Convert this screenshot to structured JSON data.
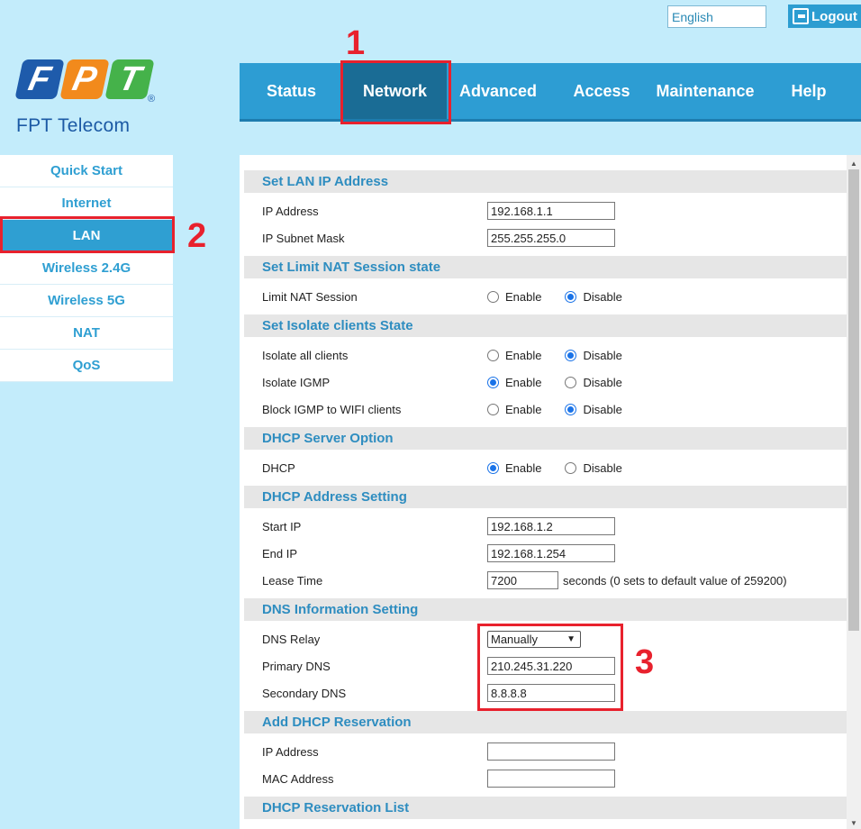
{
  "header": {
    "language": "English",
    "logout_label": "Logout",
    "brand": {
      "letters": [
        "F",
        "P",
        "T"
      ],
      "registered": "®",
      "name": "FPT Telecom"
    }
  },
  "nav": {
    "items": [
      {
        "label": "Status"
      },
      {
        "label": "Network",
        "active": true
      },
      {
        "label": "Advanced"
      },
      {
        "label": "Access"
      },
      {
        "label": "Maintenance"
      },
      {
        "label": "Help"
      }
    ]
  },
  "sidebar": {
    "items": [
      {
        "label": "Quick Start"
      },
      {
        "label": "Internet"
      },
      {
        "label": "LAN",
        "active": true
      },
      {
        "label": "Wireless 2.4G"
      },
      {
        "label": "Wireless 5G"
      },
      {
        "label": "NAT"
      },
      {
        "label": "QoS"
      }
    ]
  },
  "annotations": {
    "n1": "1",
    "n2": "2",
    "n3": "3"
  },
  "sections": {
    "lan_ip": {
      "title": "Set LAN IP Address",
      "ip_label": "IP Address",
      "ip_value": "192.168.1.1",
      "mask_label": "IP Subnet Mask",
      "mask_value": "255.255.255.0"
    },
    "nat_session": {
      "title": "Set Limit NAT Session state",
      "label": "Limit NAT Session",
      "selected": "Disable"
    },
    "isolate": {
      "title": "Set Isolate clients State",
      "all_label": "Isolate all clients",
      "all_selected": "Disable",
      "igmp_label": "Isolate IGMP",
      "igmp_selected": "Enable",
      "block_label": "Block IGMP to WIFI clients",
      "block_selected": "Disable"
    },
    "dhcp_server": {
      "title": "DHCP Server Option",
      "label": "DHCP",
      "selected": "Enable"
    },
    "dhcp_address": {
      "title": "DHCP Address Setting",
      "start_label": "Start IP",
      "start_value": "192.168.1.2",
      "end_label": "End IP",
      "end_value": "192.168.1.254",
      "lease_label": "Lease Time",
      "lease_value": "7200",
      "lease_note": "seconds (0 sets to default value of 259200)"
    },
    "dns": {
      "title": "DNS Information Setting",
      "relay_label": "DNS Relay",
      "relay_value": "Manually",
      "primary_label": "Primary DNS",
      "primary_value": "210.245.31.220",
      "secondary_label": "Secondary DNS",
      "secondary_value": "8.8.8.8"
    },
    "reservation": {
      "title": "Add DHCP Reservation",
      "ip_label": "IP Address",
      "ip_value": "",
      "mac_label": "MAC Address",
      "mac_value": ""
    },
    "reservation_list": {
      "title": "DHCP Reservation List"
    }
  },
  "options": {
    "enable": "Enable",
    "disable": "Disable"
  },
  "colors": {
    "accent": "#2d9dd3",
    "active_nav": "#1a6c95",
    "highlight": "#e8212d",
    "background": "#c3ecfb"
  }
}
